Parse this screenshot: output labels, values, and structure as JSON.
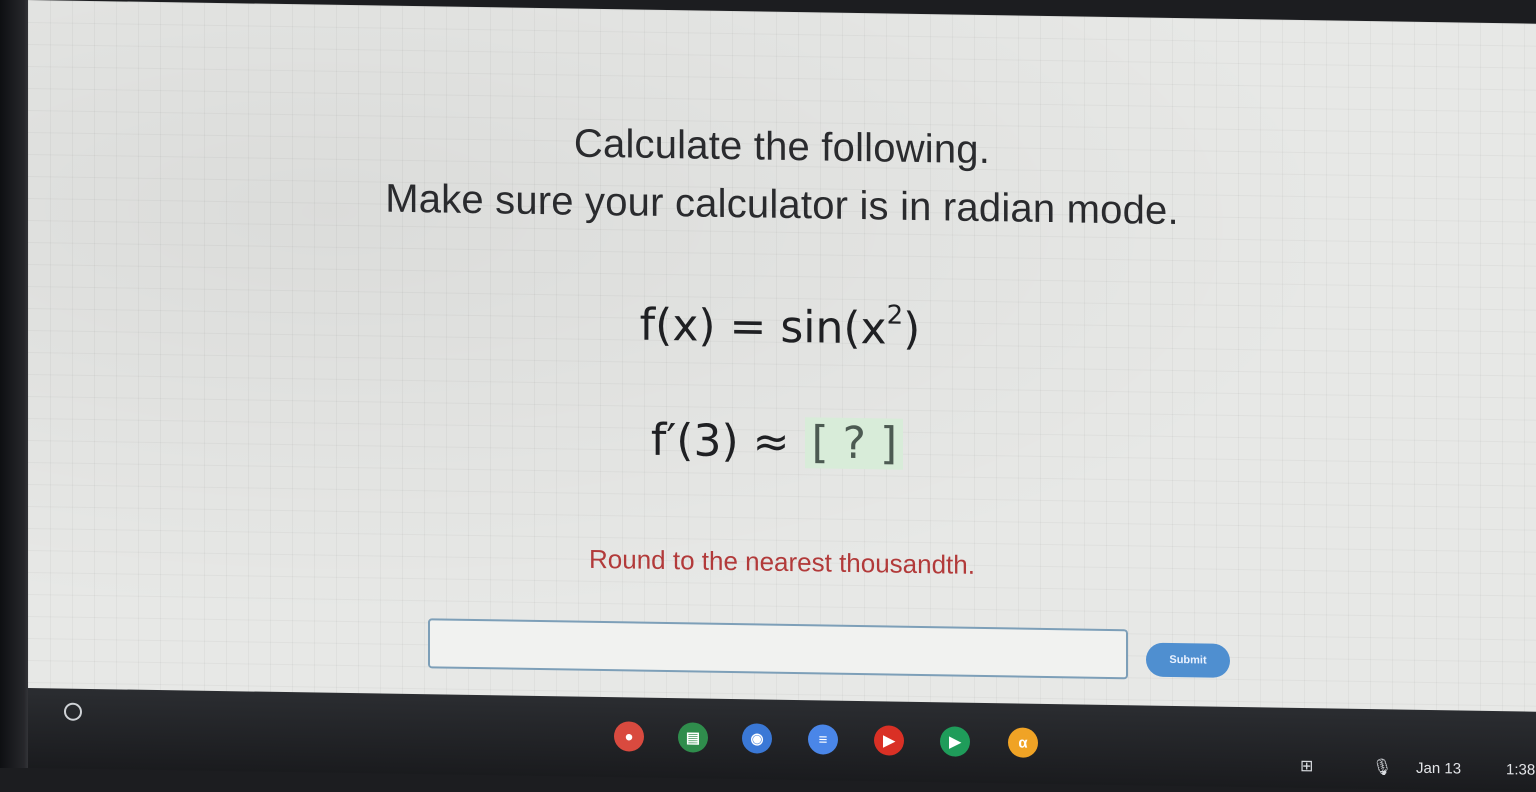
{
  "question": {
    "line1": "Calculate the following.",
    "line2": "Make sure your calculator is in radian mode.",
    "function_lhs": "f(x) = sin(x",
    "function_exponent": "2",
    "function_close": ")",
    "derivative_lhs": "f′(3) ≈ ",
    "answer_placeholder": "[ ? ]",
    "instruction": "Round to the nearest thousandth."
  },
  "answer_form": {
    "input_value": "",
    "submit_label": "Submit"
  },
  "taskbar": {
    "apps": [
      {
        "name": "app-red",
        "glyph": "●",
        "color": "#d94a3f"
      },
      {
        "name": "app-classroom",
        "glyph": "▤",
        "color": "#2f8d4c"
      },
      {
        "name": "app-chrome",
        "glyph": "◉",
        "color": "#3a78d6"
      },
      {
        "name": "app-docs",
        "glyph": "≡",
        "color": "#4a86e8"
      },
      {
        "name": "app-youtube",
        "glyph": "▶",
        "color": "#d93025"
      },
      {
        "name": "app-play",
        "glyph": "▶",
        "color": "#1f9c5a"
      },
      {
        "name": "app-alpha",
        "glyph": "α",
        "color": "#f0a325"
      }
    ],
    "date": "Jan 13",
    "time": "1:38"
  }
}
